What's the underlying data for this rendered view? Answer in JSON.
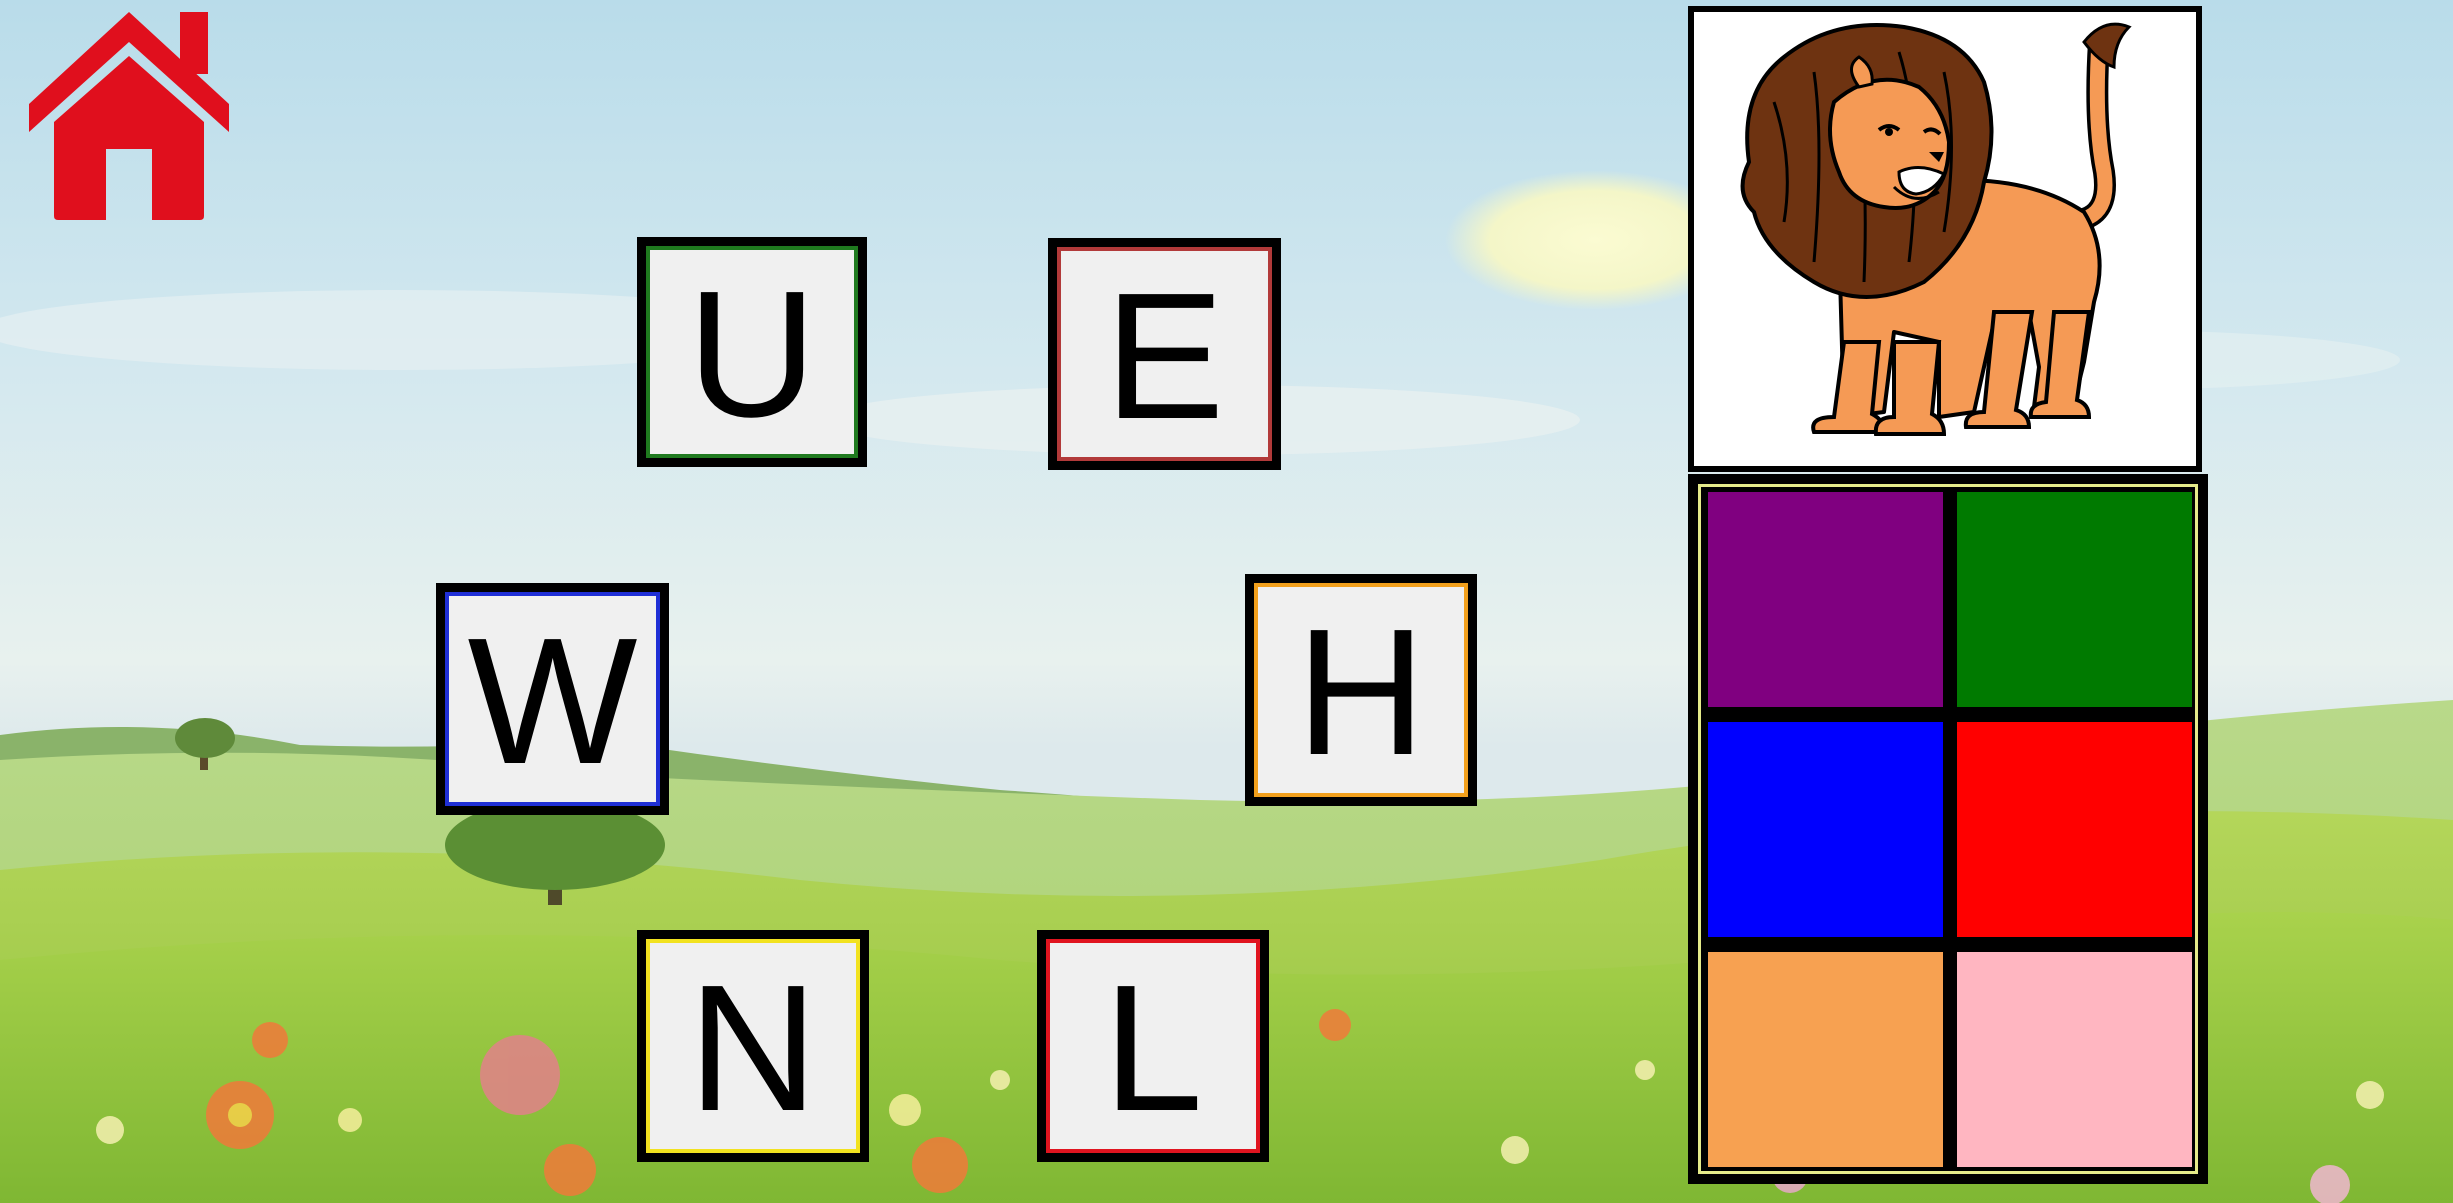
{
  "home_button": {
    "icon": "home-icon",
    "color": "#e00f1d"
  },
  "letters": [
    {
      "id": "U",
      "letter": "U",
      "border_color": "#1f7a1f"
    },
    {
      "id": "E",
      "letter": "E",
      "border_color": "#b23a3a"
    },
    {
      "id": "W",
      "letter": "W",
      "border_color": "#1f2fd6"
    },
    {
      "id": "H",
      "letter": "H",
      "border_color": "#f2a01c"
    },
    {
      "id": "N",
      "letter": "N",
      "border_color": "#f2e21f"
    },
    {
      "id": "L",
      "letter": "L",
      "border_color": "#e0141f"
    }
  ],
  "picture": {
    "subject": "lion",
    "icon": "lion-illustration"
  },
  "color_swatches": [
    {
      "name": "purple",
      "color": "#800080"
    },
    {
      "name": "green",
      "color": "#007a00"
    },
    {
      "name": "blue",
      "color": "#0000ff"
    },
    {
      "name": "red",
      "color": "#ff0000"
    },
    {
      "name": "orange",
      "color": "#f7a151"
    },
    {
      "name": "pink",
      "color": "#ffb6c1"
    }
  ]
}
